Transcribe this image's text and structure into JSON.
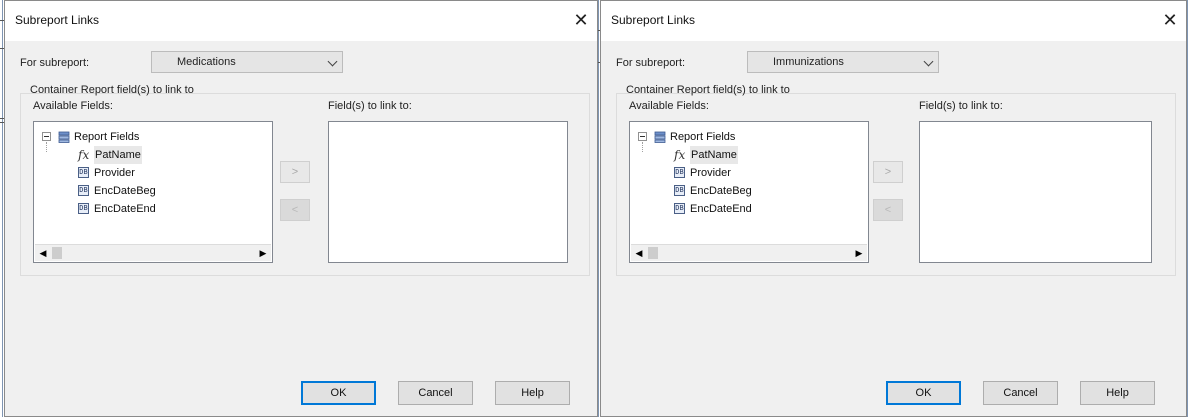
{
  "dialogs": [
    {
      "title": "Subreport Links",
      "close_glyph": "✕",
      "for_subreport_label": "For subreport:",
      "subreport_value": "Medications",
      "group_label": "Container Report field(s) to link to",
      "available_label": "Available Fields:",
      "link_label": "Field(s) to link to:",
      "tree_root": "Report Fields",
      "fields": [
        {
          "icon": "fx",
          "name": "PatName"
        },
        {
          "icon": "db",
          "name": "Provider"
        },
        {
          "icon": "db",
          "name": "EncDateBeg"
        },
        {
          "icon": "db",
          "name": "EncDateEnd"
        }
      ],
      "add_button": ">",
      "remove_button": "<",
      "ok": "OK",
      "cancel": "Cancel",
      "help": "Help"
    },
    {
      "title": "Subreport Links",
      "close_glyph": "✕",
      "for_subreport_label": "For subreport:",
      "subreport_value": "Immunizations",
      "group_label": "Container Report field(s) to link to",
      "available_label": "Available Fields:",
      "link_label": "Field(s) to link to:",
      "tree_root": "Report Fields",
      "fields": [
        {
          "icon": "fx",
          "name": "PatName"
        },
        {
          "icon": "db",
          "name": "Provider"
        },
        {
          "icon": "db",
          "name": "EncDateBeg"
        },
        {
          "icon": "db",
          "name": "EncDateEnd"
        }
      ],
      "add_button": ">",
      "remove_button": "<",
      "ok": "OK",
      "cancel": "Cancel",
      "help": "Help"
    }
  ],
  "colors": {
    "ok_focus_border": "#0078d7",
    "client_background": "#f0f0f0"
  }
}
